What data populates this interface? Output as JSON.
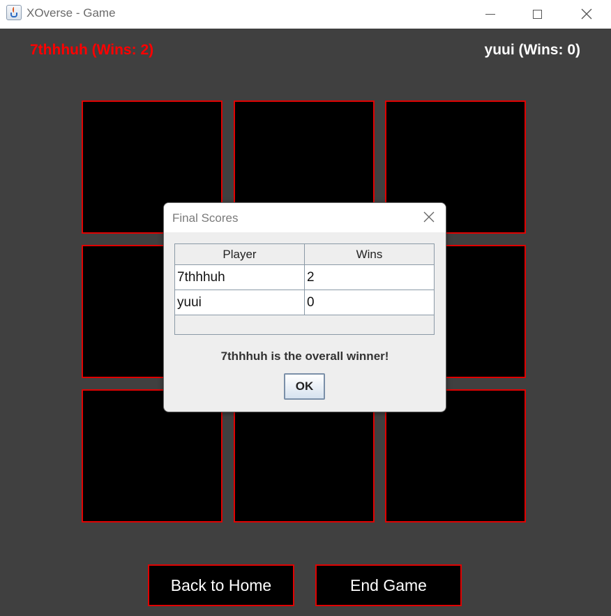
{
  "window": {
    "title": "XOverse - Game"
  },
  "players": {
    "p1_label": "7thhhuh (Wins: 2)",
    "p2_label": "yuui (Wins: 0)",
    "p1_color": "#ff0000",
    "p2_color": "#ffffff"
  },
  "board": {
    "cells": [
      "",
      "",
      "",
      "",
      "",
      "",
      "",
      "",
      ""
    ],
    "cell_border_color": "#e00000",
    "background": "#404040"
  },
  "buttons": {
    "back_home": "Back to Home",
    "end_game": "End Game"
  },
  "dialog": {
    "title": "Final Scores",
    "columns": [
      "Player",
      "Wins"
    ],
    "rows": [
      {
        "player": "7thhhuh",
        "wins": "2"
      },
      {
        "player": "yuui",
        "wins": "0"
      }
    ],
    "message": "7thhhuh is the overall winner!",
    "ok_label": "OK"
  },
  "icons": {
    "app": "java-cup-icon",
    "minimize": "minimize-icon",
    "maximize": "maximize-icon",
    "close": "close-icon"
  }
}
